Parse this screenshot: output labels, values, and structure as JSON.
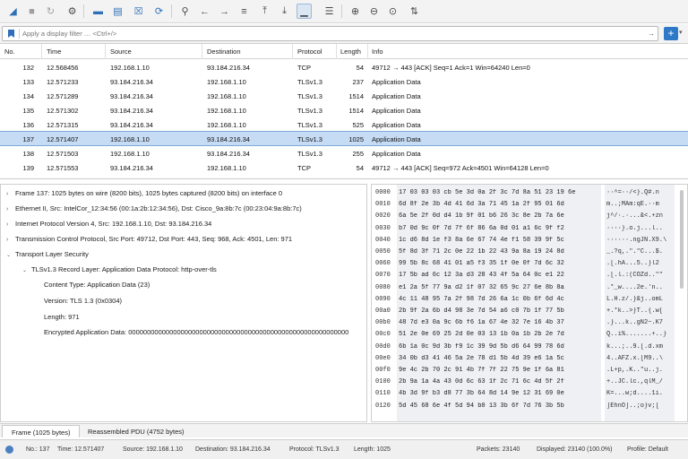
{
  "toolbar": {
    "icons": [
      "shark-fin-icon",
      "stop-icon",
      "restart-icon",
      "options-gear-icon",
      "open-folder-icon",
      "save-icon",
      "close-file-icon",
      "reload-icon",
      "find-icon",
      "back-icon",
      "forward-icon",
      "go-to-packet-icon",
      "first-packet-icon",
      "last-packet-icon",
      "autoscroll-icon",
      "colorize-icon",
      "zoom-in-icon",
      "zoom-out-icon",
      "normal-size-icon",
      "resize-columns-icon"
    ]
  },
  "filter": {
    "placeholder": "Apply a display filter … <Ctrl+/>",
    "arrow": "→",
    "plus": "+",
    "caret": "▾"
  },
  "packet_list": {
    "columns": [
      "No.",
      "Time",
      "Source",
      "Destination",
      "Protocol",
      "Length",
      "Info"
    ],
    "rows": [
      {
        "no": "132",
        "time": "12.568456",
        "src": "192.168.1.10",
        "dst": "93.184.216.34",
        "proto": "TCP",
        "len": "54",
        "info": "49712 → 443 [ACK] Seq=1 Ack=1 Win=64240 Len=0"
      },
      {
        "no": "133",
        "time": "12.571233",
        "src": "93.184.216.34",
        "dst": "192.168.1.10",
        "proto": "TLSv1.3",
        "len": "237",
        "info": "Application Data"
      },
      {
        "no": "134",
        "time": "12.571289",
        "src": "93.184.216.34",
        "dst": "192.168.1.10",
        "proto": "TLSv1.3",
        "len": "1514",
        "info": "Application Data"
      },
      {
        "no": "135",
        "time": "12.571302",
        "src": "93.184.216.34",
        "dst": "192.168.1.10",
        "proto": "TLSv1.3",
        "len": "1514",
        "info": "Application Data"
      },
      {
        "no": "136",
        "time": "12.571315",
        "src": "93.184.216.34",
        "dst": "192.168.1.10",
        "proto": "TLSv1.3",
        "len": "525",
        "info": "Application Data"
      },
      {
        "no": "137",
        "time": "12.571407",
        "src": "192.168.1.10",
        "dst": "93.184.216.34",
        "proto": "TLSv1.3",
        "len": "1025",
        "info": "Application Data"
      },
      {
        "no": "138",
        "time": "12.571503",
        "src": "192.168.1.10",
        "dst": "93.184.216.34",
        "proto": "TLSv1.3",
        "len": "255",
        "info": "Application Data"
      },
      {
        "no": "139",
        "time": "12.571553",
        "src": "93.184.216.34",
        "dst": "192.168.1.10",
        "proto": "TCP",
        "len": "54",
        "info": "49712 → 443 [ACK] Seq=972 Ack=4501 Win=64128 Len=0"
      }
    ]
  },
  "details": {
    "items": [
      {
        "text": "Frame 137: 1025 bytes on wire (8200 bits), 1025 bytes captured (8200 bits) on interface 0",
        "expand": "closed"
      },
      {
        "text": "Ethernet II, Src: IntelCor_12:34:56 (00:1a:2b:12:34:56),  Dst:  Cisco_9a:8b:7c (00:23:04:9a:8b:7c)",
        "expand": "closed"
      },
      {
        "text": "Internet Protocol Version 4, Src: 192.168.1.10, Dst: 93.184.216.34",
        "expand": "closed"
      },
      {
        "text": "Transmission Control Protocol, Src Port: 49712,  Dst Port: 443,  Seq: 968,  Ack: 4501,  Len: 971",
        "expand": "closed"
      },
      {
        "text": "Transport Layer Security",
        "expand": "open"
      },
      {
        "text": "TLSv1.3 Record Layer: Application Data  Protocol: http-over-tls",
        "expand": "open"
      },
      {
        "text": "Content Type:  Application Data (23)",
        "expand": "none"
      },
      {
        "text": "Version: TLS 1.3 (0x0304)",
        "expand": "none"
      },
      {
        "text": "Length: 971",
        "expand": "none"
      },
      {
        "text": "Encrypted Application Data:  000000000000000000000000000000000000000000000000000000000000000000000…",
        "expand": "none"
      }
    ]
  },
  "bytes": {
    "lines": [
      {
        "off": "0000",
        "hex": "17 03 03 03 cb 5e 3d 0a 2f 3c 7d 8a 51 23 19 6e",
        "ascii": "··^=··/<}.Q#.n"
      },
      {
        "off": "0010",
        "hex": "6d 8f 2e 3b 4d 41 6d 3a 71 45 1a 2f 95 01 6d",
        "ascii": "m..;MAm:qE.··m"
      },
      {
        "off": "0020",
        "hex": "6a 5e 2f 0d d4 1b 9f 01 b6 26 3c 8e 2b 7a 6e",
        "ascii": "j^/·.·...&<.+zn"
      },
      {
        "off": "0030",
        "hex": "b7 0d 9c 0f 7d 7f 6f 86 6a 0d 01 a1 6c 9f f2",
        "ascii": "····}.o.j...l.."
      },
      {
        "off": "0040",
        "hex": "1c d6 8d 1e f3 8a 6e 67 74 4e f1 58 39 9f 5c",
        "ascii": "······.ngJN.X9.\\"
      },
      {
        "off": "0050",
        "hex": "5f 8d 3f 71 2c 0e 22 1b 22 43 9a 8a 19 24 8d",
        "ascii": "_.?q,.\".\"C...$."
      },
      {
        "off": "0060",
        "hex": "99 5b 8c 68 41 01 a5 f3 35 1f 0e 0f 7d 6c 32",
        "ascii": ".[.hA...5..}l2"
      },
      {
        "off": "0070",
        "hex": "17 5b ad 6c 12 3a d3 28 43 4f 5a 64 0c e1 22",
        "ascii": ".[.l.:(COZd..\"\""
      },
      {
        "off": "0080",
        "hex": "e1 2a 5f 77 9a d2 1f 07 32 65 9c 27 6e 8b 8a",
        "ascii": ".*_w....2e.'n.."
      },
      {
        "off": "0090",
        "hex": "4c 11 48 95 7a 2f 98 7d 26 6a 1c 0b 6f 6d 4c",
        "ascii": "L.H.z/.}&j..omL"
      },
      {
        "off": "00a0",
        "hex": "2b 9f 2a 6b d4 98 3e 7d 54 a6 c0 7b 1f 77 5b",
        "ascii": "+.*k..>}T..{.w["
      },
      {
        "off": "00b0",
        "hex": "48 7d e3 0a 9c 6b f6 1a 67 4e 32 7e 16 4b 37",
        "ascii": ".}...k..gN2~.K7"
      },
      {
        "off": "00c0",
        "hex": "51 2e 0e 69 25 2d 0e 03 13 1b 0a 1b 2b 2e 7d",
        "ascii": "Q..i%.......+..}"
      },
      {
        "off": "00d0",
        "hex": "6b 1a 0c 9d 3b f9 1c 39 9d 5b d6 64 99 78 6d",
        "ascii": "k...;..9.[.d.xm"
      },
      {
        "off": "00e0",
        "hex": "34 0b d3 41 46 5a 2e 78 d1 5b 4d 39 e6 1a 5c",
        "ascii": "4..AFZ.x.[M9..\\"
      },
      {
        "off": "00f0",
        "hex": "9e 4c 2b 70 2c 91 4b 7f 7f 22 75 9e 1f 6a 81",
        "ascii": ".L+p,.K..\"u..j."
      },
      {
        "off": "0100",
        "hex": "2b 9a 1a 4a 43 0d 6c 63 1f 2c 71 6c 4d 5f 2f",
        "ascii": "+..JC.lc.,qlM_/"
      },
      {
        "off": "0110",
        "hex": "4b 3d 9f b3 d8 77 3b 64 8d 14 9e 12 31 69 0e",
        "ascii": "K=...w;d....1i."
      },
      {
        "off": "0120",
        "hex": "5d 45 68 6e 4f 5d 94 b0 13 3b 6f 7d 76 3b 5b",
        "ascii": "]EhnO]..;o}v;["
      }
    ]
  },
  "bottom_tabs": [
    "Frame (1025 bytes)",
    "Reassembled PDU (4752 bytes)"
  ],
  "status": {
    "no": "No.: 137",
    "time": "Time: 12.571407",
    "source": "Source: 192.168.1.10",
    "destination": "Destination: 93.184.216.34",
    "protocol": "Protocol: TLSv1.3",
    "length": "Length: 1025",
    "packets": "Packets: 23140",
    "displayed": "Displayed: 23140 (100.0%)",
    "profile": "Profile: Default"
  },
  "colors": {
    "accent": "#2e78c8",
    "selected_row": "#c6dbf4"
  }
}
